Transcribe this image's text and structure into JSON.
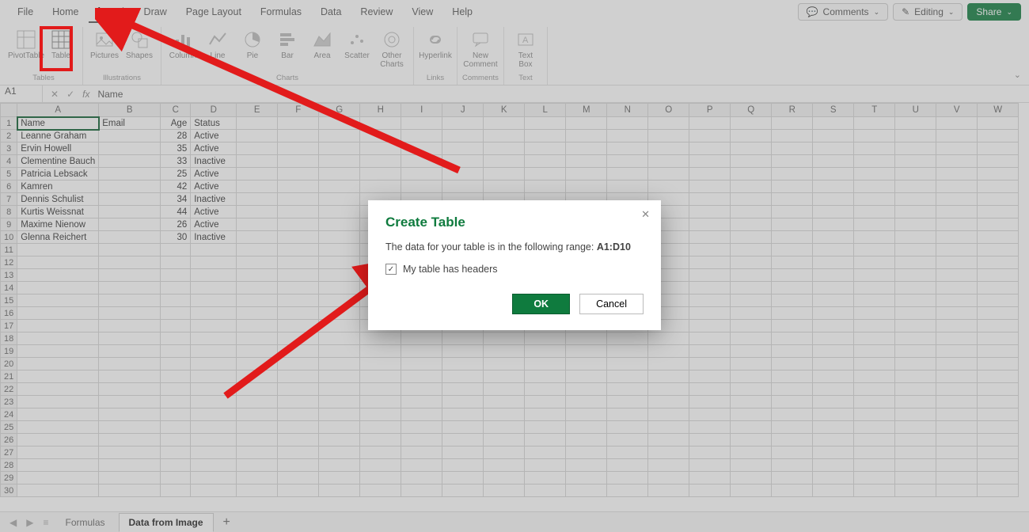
{
  "menu": {
    "items": [
      "File",
      "Home",
      "Insert",
      "Draw",
      "Page Layout",
      "Formulas",
      "Data",
      "Review",
      "View",
      "Help"
    ],
    "active": "Insert"
  },
  "topright": {
    "comments": "Comments",
    "editing": "Editing",
    "share": "Share"
  },
  "ribbon": {
    "groups": [
      {
        "cap": "Tables",
        "items": [
          {
            "l": "PivotTable"
          },
          {
            "l": "Table"
          }
        ]
      },
      {
        "cap": "Illustrations",
        "items": [
          {
            "l": "Pictures"
          },
          {
            "l": "Shapes"
          }
        ]
      },
      {
        "cap": "Charts",
        "items": [
          {
            "l": "Column"
          },
          {
            "l": "Line"
          },
          {
            "l": "Pie"
          },
          {
            "l": "Bar"
          },
          {
            "l": "Area"
          },
          {
            "l": "Scatter"
          },
          {
            "l": "Other Charts"
          }
        ]
      },
      {
        "cap": "Links",
        "items": [
          {
            "l": "Hyperlink"
          }
        ]
      },
      {
        "cap": "Comments",
        "items": [
          {
            "l": "New Comment"
          }
        ]
      },
      {
        "cap": "Text",
        "items": [
          {
            "l": "Text Box"
          }
        ]
      }
    ]
  },
  "fx": {
    "cell": "A1",
    "value": "Name"
  },
  "cols": [
    "A",
    "B",
    "C",
    "D",
    "E",
    "F",
    "G",
    "H",
    "I",
    "J",
    "K",
    "L",
    "M",
    "N",
    "O",
    "P",
    "Q",
    "R",
    "S",
    "T",
    "U",
    "V",
    "W"
  ],
  "rows": [
    {
      "A": "Name",
      "B": "Email",
      "C": "Age",
      "D": "Status"
    },
    {
      "A": "Leanne Graham",
      "C": "28",
      "D": "Active"
    },
    {
      "A": "Ervin Howell",
      "C": "35",
      "D": "Active"
    },
    {
      "A": "Clementine Bauch",
      "C": "33",
      "D": "Inactive"
    },
    {
      "A": "Patricia Lebsack",
      "C": "25",
      "D": "Active"
    },
    {
      "A": "Kamren",
      "C": "42",
      "D": "Active"
    },
    {
      "A": "Dennis Schulist",
      "C": "34",
      "D": "Inactive"
    },
    {
      "A": "Kurtis Weissnat",
      "C": "44",
      "D": "Active"
    },
    {
      "A": "Maxime Nienow",
      "C": "26",
      "D": "Active"
    },
    {
      "A": "Glenna Reichert",
      "C": "30",
      "D": "Inactive"
    }
  ],
  "totalrows": 30,
  "tabs": {
    "items": [
      "Formulas",
      "Data from Image"
    ],
    "active": "Data from Image"
  },
  "dialog": {
    "title": "Create Table",
    "msg_pre": "The data for your table is in the following range: ",
    "range": "A1:D10",
    "checkbox": "My table has headers",
    "ok": "OK",
    "cancel": "Cancel"
  }
}
